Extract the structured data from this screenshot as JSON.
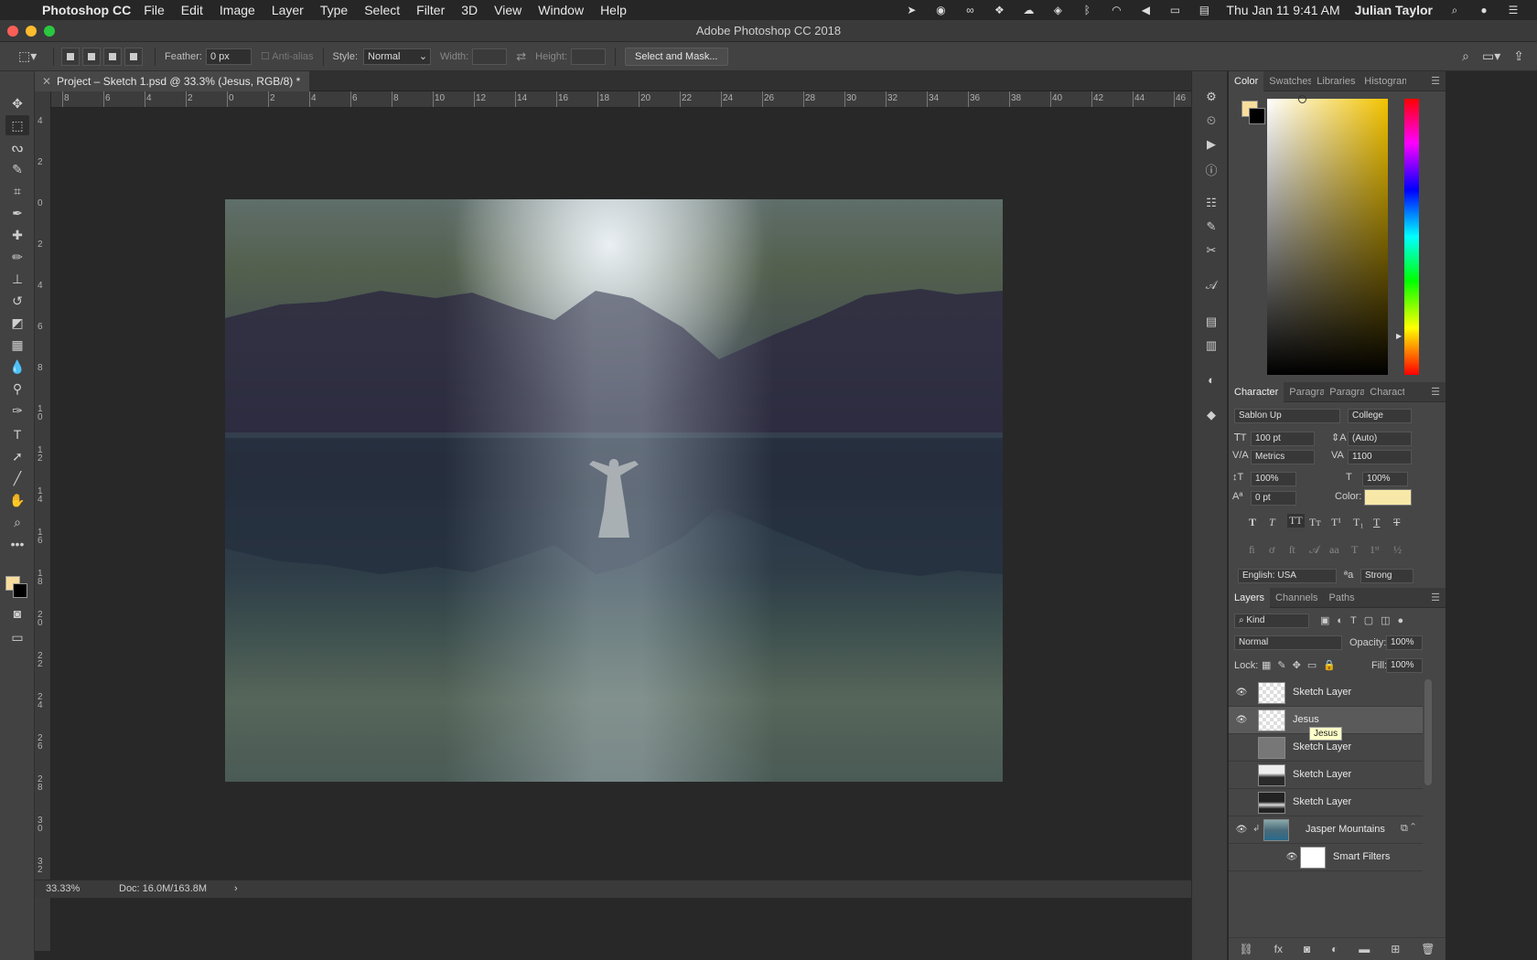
{
  "menubar": {
    "app_name": "Photoshop CC",
    "items": [
      "File",
      "Edit",
      "Image",
      "Layer",
      "Type",
      "Select",
      "Filter",
      "3D",
      "View",
      "Window",
      "Help"
    ],
    "clock": "Thu Jan 11  9:41 AM",
    "user": "Julian Taylor"
  },
  "window": {
    "title": "Adobe Photoshop CC 2018"
  },
  "options": {
    "feather_label": "Feather:",
    "feather_value": "0 px",
    "antialias_label": "Anti-alias",
    "style_label": "Style:",
    "style_value": "Normal",
    "width_label": "Width:",
    "height_label": "Height:",
    "select_mask_label": "Select and Mask..."
  },
  "document": {
    "tab_title": "Project – Sketch 1.psd @ 33.3% (Jesus, RGB/8) *",
    "zoom": "33.33%",
    "doc_size": "Doc: 16.0M/163.8M"
  },
  "ruler": {
    "h_ticks": [
      "8",
      "6",
      "4",
      "2",
      "0",
      "2",
      "4",
      "6",
      "8",
      "10",
      "12",
      "14",
      "16",
      "18",
      "20",
      "22",
      "24",
      "26",
      "28",
      "30",
      "32",
      "34",
      "36",
      "38",
      "40",
      "42",
      "44",
      "46"
    ],
    "v_ticks": [
      "4",
      "2",
      "0",
      "2",
      "4",
      "6",
      "8",
      "1\n0",
      "1\n2",
      "1\n4",
      "1\n6",
      "1\n8",
      "2\n0",
      "2\n2",
      "2\n4",
      "2\n6",
      "2\n8",
      "3\n0",
      "3\n2"
    ]
  },
  "color_panel": {
    "tabs": [
      "Color",
      "Swatches",
      "Libraries",
      "Histogram"
    ],
    "foreground": "#f8dd9c",
    "background": "#000000"
  },
  "character_panel": {
    "tabs": [
      "Character",
      "Paragraph",
      "Paragraph Styles",
      "Character Styles"
    ],
    "font_family": "Sablon Up",
    "font_style": "College",
    "size": "100 pt",
    "leading": "(Auto)",
    "kerning": "Metrics",
    "tracking": "1100",
    "vscale": "100%",
    "hscale": "100%",
    "baseline": "0 pt",
    "color_label": "Color:",
    "color_value": "#f8e8a8",
    "language": "English: USA",
    "antialias": "Strong"
  },
  "layers_panel": {
    "tabs": [
      "Layers",
      "Channels",
      "Paths"
    ],
    "filter": "Kind",
    "blend_mode": "Normal",
    "opacity_label": "Opacity:",
    "opacity": "100%",
    "lock_label": "Lock:",
    "fill_label": "Fill:",
    "fill": "100%",
    "layers": [
      {
        "name": "Sketch Layer",
        "visible": true,
        "selected": false
      },
      {
        "name": "Jesus",
        "visible": true,
        "selected": true
      },
      {
        "name": "Sketch Layer",
        "visible": false,
        "selected": false
      },
      {
        "name": "Sketch Layer",
        "visible": false,
        "selected": false
      },
      {
        "name": "Sketch Layer",
        "visible": false,
        "selected": false
      },
      {
        "name": "Jasper Mountains",
        "visible": true,
        "selected": false
      },
      {
        "name": "Smart Filters",
        "visible": true,
        "selected": false
      }
    ],
    "tooltip": "Jesus"
  }
}
